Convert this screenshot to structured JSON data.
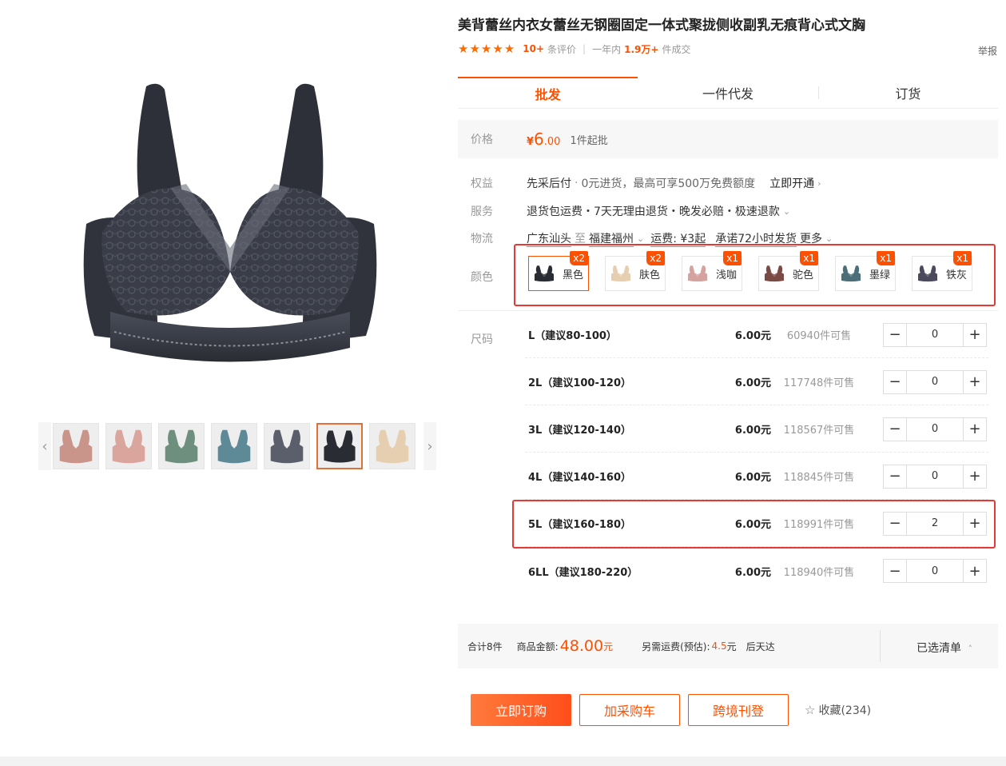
{
  "product": {
    "title": "美背蕾丝内衣女蕾丝无钢圈固定一体式聚拢侧收副乳无痕背心式文胸",
    "rating_count": "10+",
    "rating_label": "条评价",
    "period": "一年内",
    "sold_count": "1.9万+",
    "sold_label": "件成交",
    "report": "举报",
    "stars": 5
  },
  "tabs": [
    {
      "label": "批发",
      "active": true
    },
    {
      "label": "一件代发",
      "active": false
    },
    {
      "label": "订货",
      "active": false
    }
  ],
  "price": {
    "label": "价格",
    "currency": "¥",
    "integer": "6",
    "decimal": ".00",
    "min_order": "1件起批"
  },
  "benefits": {
    "label": "权益",
    "title": "先采后付",
    "detail": "0元进货，最高可享500万免费额度",
    "link": "立即开通"
  },
  "service": {
    "label": "服务",
    "text": "退货包运费・7天无理由退货・晚发必赔・极速退款"
  },
  "logistics": {
    "label": "物流",
    "from": "广东汕头",
    "to_word": "至",
    "to": "福建福州",
    "freight": "运费: ¥3起",
    "promise": "承诺72小时发货",
    "more": "更多"
  },
  "colors": {
    "label": "颜色",
    "items": [
      {
        "name": "黑色",
        "badge": "x2",
        "swatch": "#2a2c33",
        "active": true
      },
      {
        "name": "肤色",
        "badge": "x2",
        "swatch": "#e6cfb0",
        "active": false
      },
      {
        "name": "浅咖",
        "badge": "x1",
        "swatch": "#d4a3a0",
        "active": false
      },
      {
        "name": "驼色",
        "badge": "x1",
        "swatch": "#7a4a44",
        "active": false
      },
      {
        "name": "墨绿",
        "badge": "x1",
        "swatch": "#4c6e78",
        "active": false
      },
      {
        "name": "铁灰",
        "badge": "x1",
        "swatch": "#4a4a5c",
        "active": false
      }
    ]
  },
  "sizes": {
    "label": "尺码",
    "rows": [
      {
        "name": "L（建议80-100）",
        "price": "6.00元",
        "stock": "60940件可售",
        "qty": "0"
      },
      {
        "name": "2L（建议100-120）",
        "price": "6.00元",
        "stock": "117748件可售",
        "qty": "0"
      },
      {
        "name": "3L（建议120-140）",
        "price": "6.00元",
        "stock": "118567件可售",
        "qty": "0"
      },
      {
        "name": "4L（建议140-160）",
        "price": "6.00元",
        "stock": "118845件可售",
        "qty": "0"
      },
      {
        "name": "5L（建议160-180）",
        "price": "6.00元",
        "stock": "118991件可售",
        "qty": "2"
      },
      {
        "name": "6LL（建议180-220）",
        "price": "6.00元",
        "stock": "118940件可售",
        "qty": "0"
      }
    ],
    "minus": "−",
    "plus": "+"
  },
  "summary": {
    "total_pieces": "合计8件",
    "amount_label": "商品金额:",
    "amount": "48.00",
    "amount_unit": "元",
    "shipping_label": "另需运费(预估):",
    "shipping": "4.5",
    "shipping_unit": "元",
    "eta": "后天达",
    "selected_list": "已选清单"
  },
  "actions": {
    "order": "立即订购",
    "cart": "加采购车",
    "crossborder": "跨境刊登",
    "favorite": "收藏(234)"
  },
  "gallery": {
    "thumbs": [
      {
        "color": "#c9958a",
        "active": false
      },
      {
        "color": "#d9a59d",
        "active": false
      },
      {
        "color": "#6f8f7e",
        "active": false
      },
      {
        "color": "#5d8a96",
        "active": false
      },
      {
        "color": "#5a5f6b",
        "active": false
      },
      {
        "color": "#2a2c33",
        "active": true
      },
      {
        "color": "#e6cfb0",
        "active": false
      }
    ],
    "main_color": "#2f323b",
    "accent_color": "#ff5000"
  }
}
